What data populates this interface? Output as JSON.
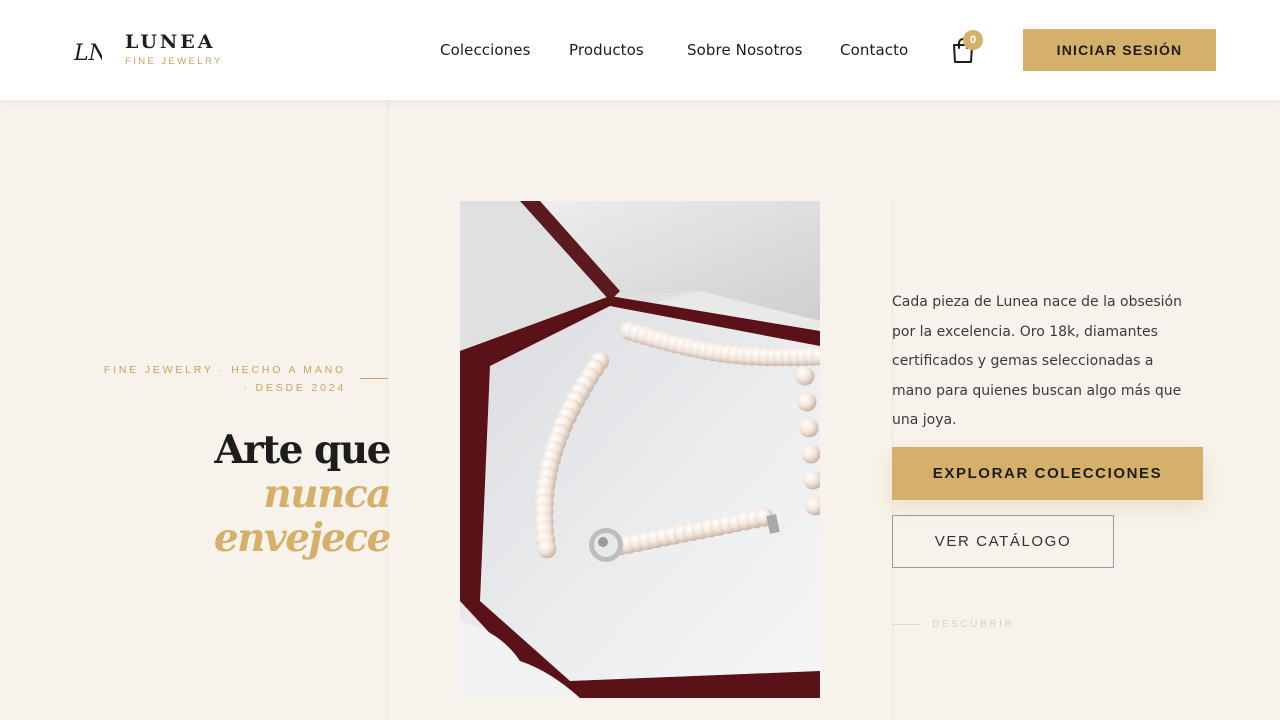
{
  "brand": {
    "monogram": "LN",
    "name": "LUNEA",
    "tagline": "FINE JEWELRY"
  },
  "nav": {
    "items": [
      {
        "label": "Colecciones"
      },
      {
        "label": "Productos"
      },
      {
        "label": "Sobre Nosotros"
      },
      {
        "label": "Contacto"
      }
    ],
    "cart_icon": "shopping-bag-icon",
    "cart_count": "0",
    "login_label": "INICIAR SESIÓN"
  },
  "hero": {
    "eyebrow_line1": "FINE JEWELRY · HECHO A MANO",
    "eyebrow_line2": "· DESDE 2024",
    "title_line1": "Arte que",
    "title_line2": "nunca",
    "title_line3": "envejece",
    "description": "Cada pieza de Lunea nace de la obsesión por la excelencia. Oro 18k, diamantes certificados y gemas seleccionadas a mano para quienes buscan algo más que una joya.",
    "primary_cta": "EXPLORAR COLECCIONES",
    "secondary_cta": "VER CATÁLOGO",
    "scroll_hint": "DESCUBRIR",
    "image_subject": "pearl-necklace-in-box"
  },
  "colors": {
    "accent_gold": "#d4b06a",
    "background": "#f7f3ec",
    "text_dark": "#1d1d1d"
  }
}
